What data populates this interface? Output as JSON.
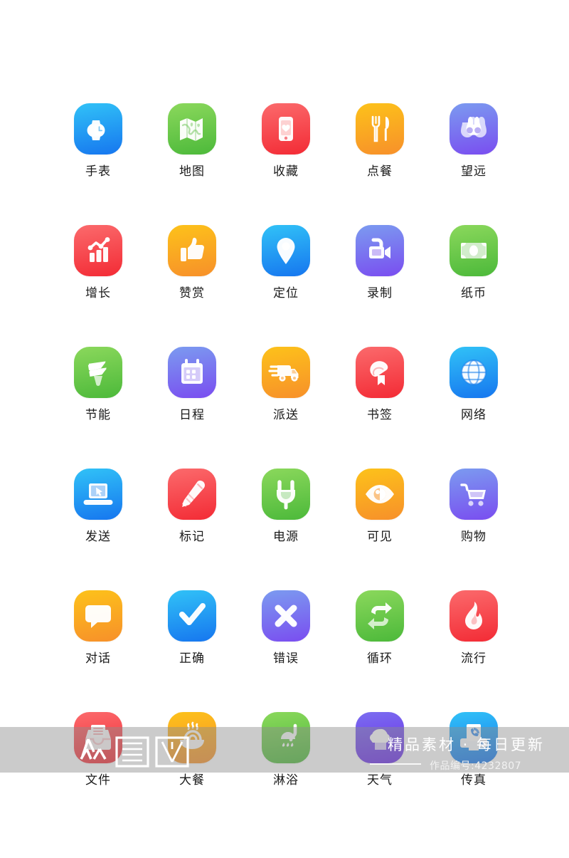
{
  "page": {
    "background": "#ffffff",
    "columns": 5,
    "rows": 6,
    "label_color": "#1a1a1a"
  },
  "icons": [
    {
      "label": "手表",
      "glyph": "watch-icon",
      "c1": "#31c2f7",
      "c2": "#1676ef"
    },
    {
      "label": "地图",
      "glyph": "map-icon",
      "c1": "#8bd85c",
      "c2": "#4cb93a"
    },
    {
      "label": "收藏",
      "glyph": "phone-heart-icon",
      "c1": "#fb6a6c",
      "c2": "#f32b35"
    },
    {
      "label": "点餐",
      "glyph": "cutlery-icon",
      "c1": "#fdc21a",
      "c2": "#f7902a"
    },
    {
      "label": "望远",
      "glyph": "binoculars-icon",
      "c1": "#7b9bf0",
      "c2": "#7a4df0"
    },
    {
      "label": "增长",
      "glyph": "growth-chart-icon",
      "c1": "#fb6a6c",
      "c2": "#f32b35"
    },
    {
      "label": "赞赏",
      "glyph": "thumbs-up-icon",
      "c1": "#fdc21a",
      "c2": "#f7902a"
    },
    {
      "label": "定位",
      "glyph": "map-pin-icon",
      "c1": "#31c2f7",
      "c2": "#1676ef"
    },
    {
      "label": "录制",
      "glyph": "video-camera-icon",
      "c1": "#7b9bf0",
      "c2": "#7a4df0"
    },
    {
      "label": "纸币",
      "glyph": "banknote-icon",
      "c1": "#8bd85c",
      "c2": "#4cb93a"
    },
    {
      "label": "节能",
      "glyph": "energy-bulb-icon",
      "c1": "#8bd85c",
      "c2": "#4cb93a"
    },
    {
      "label": "日程",
      "glyph": "calendar-icon",
      "c1": "#7b9bf0",
      "c2": "#7a4df0"
    },
    {
      "label": "派送",
      "glyph": "delivery-truck-icon",
      "c1": "#fdc21a",
      "c2": "#f7902a"
    },
    {
      "label": "书签",
      "glyph": "bookmark-icon",
      "c1": "#fb6a6c",
      "c2": "#f32b35"
    },
    {
      "label": "网络",
      "glyph": "globe-icon",
      "c1": "#31c2f7",
      "c2": "#1676ef"
    },
    {
      "label": "发送",
      "glyph": "laptop-cursor-icon",
      "c1": "#31c2f7",
      "c2": "#1676ef"
    },
    {
      "label": "标记",
      "glyph": "pencil-icon",
      "c1": "#fb6a6c",
      "c2": "#f32b35"
    },
    {
      "label": "电源",
      "glyph": "power-plug-icon",
      "c1": "#8bd85c",
      "c2": "#4cb93a"
    },
    {
      "label": "可见",
      "glyph": "eye-icon",
      "c1": "#fdc21a",
      "c2": "#f7902a"
    },
    {
      "label": "购物",
      "glyph": "shopping-cart-icon",
      "c1": "#7b9bf0",
      "c2": "#7a4df0"
    },
    {
      "label": "对话",
      "glyph": "chat-bubble-icon",
      "c1": "#fdc21a",
      "c2": "#f7902a"
    },
    {
      "label": "正确",
      "glyph": "check-icon",
      "c1": "#31c2f7",
      "c2": "#1676ef"
    },
    {
      "label": "错误",
      "glyph": "cross-icon",
      "c1": "#7b9bf0",
      "c2": "#7a4df0"
    },
    {
      "label": "循环",
      "glyph": "repeat-icon",
      "c1": "#8bd85c",
      "c2": "#4cb93a"
    },
    {
      "label": "流行",
      "glyph": "flame-icon",
      "c1": "#fb6a6c",
      "c2": "#f32b35"
    },
    {
      "label": "文件",
      "glyph": "file-tray-icon",
      "c1": "#fb6a6c",
      "c2": "#f32b35"
    },
    {
      "label": "大餐",
      "glyph": "hot-meal-icon",
      "c1": "#fdc21a",
      "c2": "#f7902a"
    },
    {
      "label": "淋浴",
      "glyph": "shower-icon",
      "c1": "#8bd85c",
      "c2": "#4cb93a"
    },
    {
      "label": "天气",
      "glyph": "cloud-icon",
      "c1": "#7b6ef0",
      "c2": "#6a2ae8"
    },
    {
      "label": "传真",
      "glyph": "fax-icon",
      "c1": "#31c2f7",
      "c2": "#1676ef"
    }
  ],
  "watermark": {
    "logo_text": "众图网",
    "tagline": "精品素材 · 每日更新",
    "work_id": "作品编号:4232807",
    "band_color": "#8c8c8c",
    "text_color": "#ffffff"
  }
}
